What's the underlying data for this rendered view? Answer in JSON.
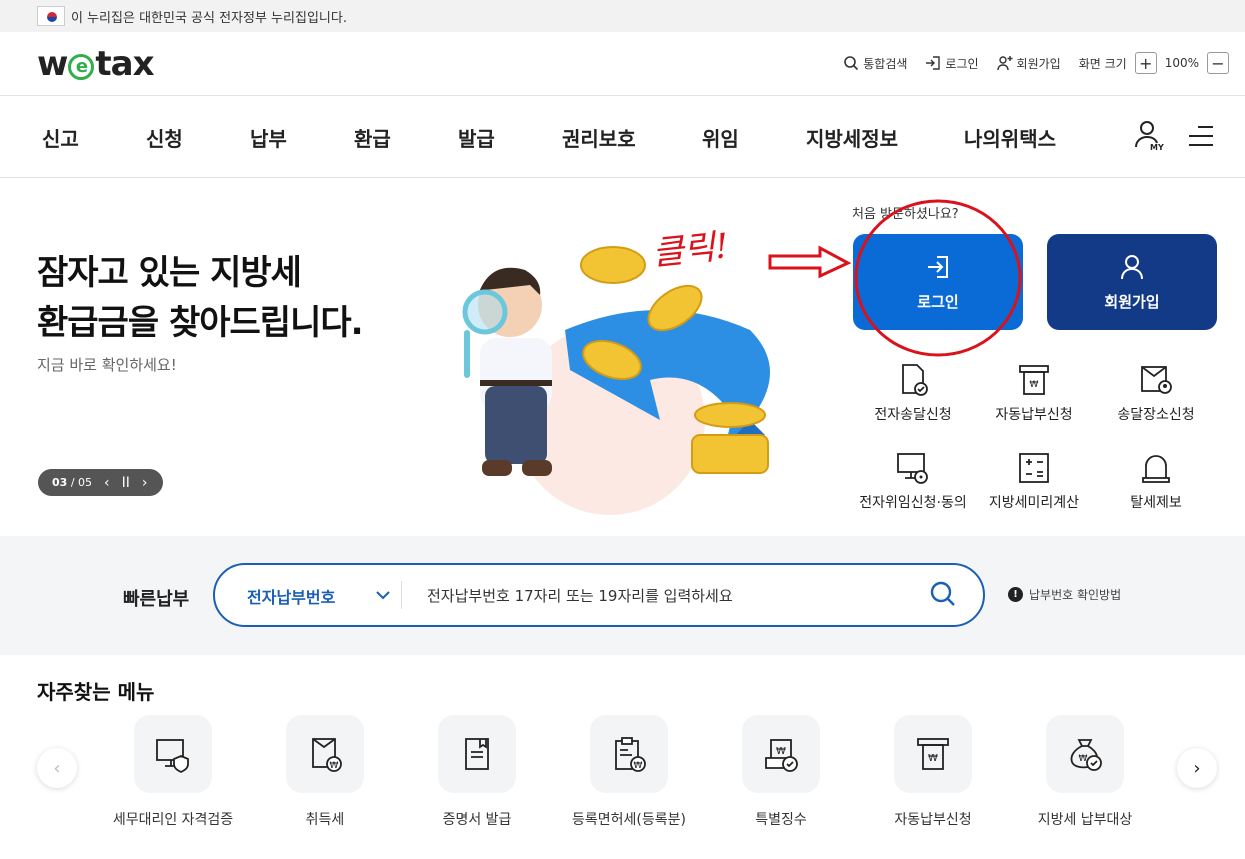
{
  "gov_banner": {
    "text": "이 누리집은 대한민국 공식 전자정부 누리집입니다."
  },
  "logo": {
    "pre": "w",
    "e": "e",
    "post": "tax"
  },
  "utility": {
    "search": "통합검색",
    "login": "로그인",
    "signup": "회원가입",
    "screen_size": "화면 크기",
    "zoom_in": "+",
    "zoom_level": "100%",
    "zoom_out": "−"
  },
  "gnb": [
    "신고",
    "신청",
    "납부",
    "환급",
    "발급",
    "권리보호",
    "위임",
    "지방세정보",
    "나의위택스"
  ],
  "gnb_my": "MY",
  "hero": {
    "title_line1": "잠자고 있는 지방세",
    "title_line2": "환급금을 찾아드립니다.",
    "subtitle": "지금 바로 확인하세요!",
    "pager_current": "03",
    "pager_total": "/ 05",
    "prev": "‹",
    "pause": "II",
    "next": "›"
  },
  "quick_access": {
    "prompt": "처음 방문하셨나요?",
    "login": "로그인",
    "signup": "회원가입",
    "services": [
      "전자송달신청",
      "자동납부신청",
      "송달장소신청",
      "전자위임신청·동의",
      "지방세미리계산",
      "탈세제보"
    ]
  },
  "quick_pay": {
    "label": "빠른납부",
    "select_value": "전자납부번호",
    "placeholder": "전자납부번호 17자리 또는 19자리를 입력하세요",
    "help_icon": "!",
    "help": "납부번호 확인방법"
  },
  "frequent": {
    "title": "자주찾는 메뉴",
    "items": [
      "세무대리인 자격검증",
      "취득세",
      "증명서 발급",
      "등록면허세(등록분)",
      "특별징수",
      "자동납부신청",
      "지방세 납부대상"
    ],
    "prev": "‹",
    "next": "›"
  },
  "annotation": {
    "text": "클릭!"
  },
  "colors": {
    "primary": "#0a6bd6",
    "navy": "#123a87",
    "annotation": "#d9121b",
    "logo_green": "#2fae4a"
  }
}
